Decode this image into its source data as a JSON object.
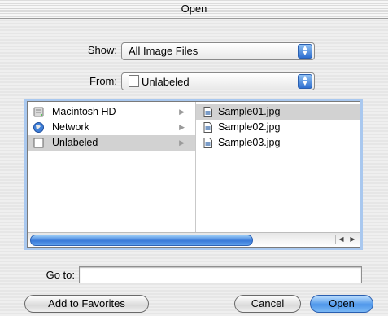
{
  "window": {
    "title": "Open"
  },
  "show": {
    "label": "Show:",
    "value": "All Image Files"
  },
  "from": {
    "label": "From:",
    "value": "Unlabeled"
  },
  "browser": {
    "column1": [
      {
        "name": "Macintosh HD",
        "icon": "hard-disk-icon"
      },
      {
        "name": "Network",
        "icon": "globe-icon"
      },
      {
        "name": "Unlabeled",
        "icon": "volume-icon",
        "selected": true
      }
    ],
    "column2": [
      {
        "name": "Sample01.jpg",
        "icon": "image-file-icon",
        "selected": true
      },
      {
        "name": "Sample02.jpg",
        "icon": "image-file-icon"
      },
      {
        "name": "Sample03.jpg",
        "icon": "image-file-icon"
      }
    ]
  },
  "goto": {
    "label": "Go to:",
    "value": ""
  },
  "buttons": {
    "favorites": "Add to Favorites",
    "cancel": "Cancel",
    "open": "Open"
  },
  "colors": {
    "accent": "#3879d9",
    "selection": "#d2d2d2",
    "focus_ring": "#a9c8ef"
  }
}
